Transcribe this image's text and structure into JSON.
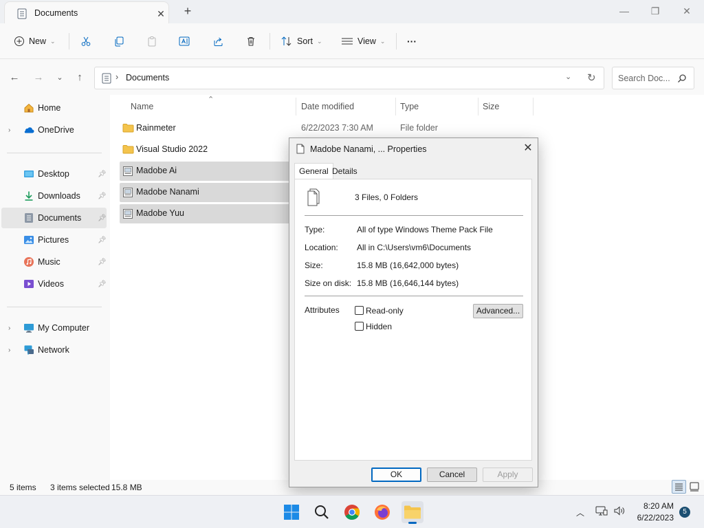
{
  "window": {
    "tab_title": "Documents",
    "new_tab": "+",
    "minimize": "—",
    "maximize": "❐",
    "close": "✕"
  },
  "toolbar": {
    "new_label": "New",
    "sort_label": "Sort",
    "view_label": "View",
    "more_label": "···"
  },
  "address": {
    "path_chevron": "›",
    "path": "Documents",
    "search_placeholder": "Search Doc..."
  },
  "sidebar": {
    "items": [
      {
        "label": "Home"
      },
      {
        "label": "OneDrive"
      },
      {
        "label": "Desktop"
      },
      {
        "label": "Downloads"
      },
      {
        "label": "Documents"
      },
      {
        "label": "Pictures"
      },
      {
        "label": "Music"
      },
      {
        "label": "Videos"
      },
      {
        "label": "My Computer"
      },
      {
        "label": "Network"
      }
    ]
  },
  "filelist": {
    "columns": [
      "Name",
      "Date modified",
      "Type",
      "Size"
    ],
    "rows": [
      {
        "name": "Rainmeter",
        "date": "6/22/2023 7:30 AM",
        "type": "File folder",
        "icon": "folder-icon"
      },
      {
        "name": "Visual Studio 2022",
        "date": "",
        "type": "",
        "icon": "folder-icon"
      },
      {
        "name": "Madobe Ai",
        "date": "",
        "type": "",
        "icon": "theme-file-icon"
      },
      {
        "name": "Madobe Nanami",
        "date": "",
        "type": "",
        "icon": "theme-file-icon"
      },
      {
        "name": "Madobe Yuu",
        "date": "",
        "type": "",
        "icon": "theme-file-icon"
      }
    ]
  },
  "status": {
    "count": "5 items",
    "selection": "3 items selected",
    "size": "15.8 MB"
  },
  "dialog": {
    "title": "Madobe Nanami, ... Properties",
    "tabs": [
      "General",
      "Details"
    ],
    "summary": "3 Files, 0 Folders",
    "type_label": "Type:",
    "type_value": "All of type Windows Theme Pack File",
    "location_label": "Location:",
    "location_value": "All in C:\\Users\\vm6\\Documents",
    "size_label": "Size:",
    "size_value": "15.8 MB (16,642,000 bytes)",
    "disk_label": "Size on disk:",
    "disk_value": "15.8 MB (16,646,144 bytes)",
    "attributes_label": "Attributes",
    "readonly_label": "Read-only",
    "hidden_label": "Hidden",
    "advanced_label": "Advanced...",
    "ok_label": "OK",
    "cancel_label": "Cancel",
    "apply_label": "Apply"
  },
  "taskbar": {
    "time": "8:20 AM",
    "date": "6/22/2023",
    "notification_count": "5"
  },
  "colors": {
    "accent": "#0067c0",
    "selection": "#d9d9d9",
    "folder": "#f4c44d"
  }
}
